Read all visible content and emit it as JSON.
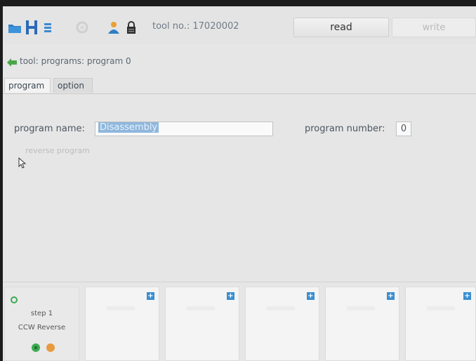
{
  "toolbar": {
    "icons": [
      "folder-icon",
      "save-icon",
      "list-icon",
      "settings-icon",
      "user-icon",
      "lock-icon"
    ],
    "tool_no_label": "tool no.:",
    "tool_no_value": "17020002",
    "read_label": "read",
    "write_label": "write"
  },
  "breadcrumb": {
    "text": "tool: programs: program 0"
  },
  "tabs": [
    {
      "label": "program",
      "active": true
    },
    {
      "label": "option",
      "active": false
    }
  ],
  "form": {
    "program_name_label": "program name:",
    "program_name_value": "Disassembly",
    "program_number_label": "program number:",
    "program_number_value": "0",
    "reverse_label": "reverse program"
  },
  "steps": {
    "first": {
      "title": "step 1",
      "subtitle": "CCW Reverse"
    },
    "empty_count": 5
  },
  "colors": {
    "accent": "#3a8fd0",
    "selection": "#8fb7dd",
    "crumb_arrow": "#4aa64a",
    "status_green": "#3daa52",
    "status_orange": "#e89a3c"
  }
}
